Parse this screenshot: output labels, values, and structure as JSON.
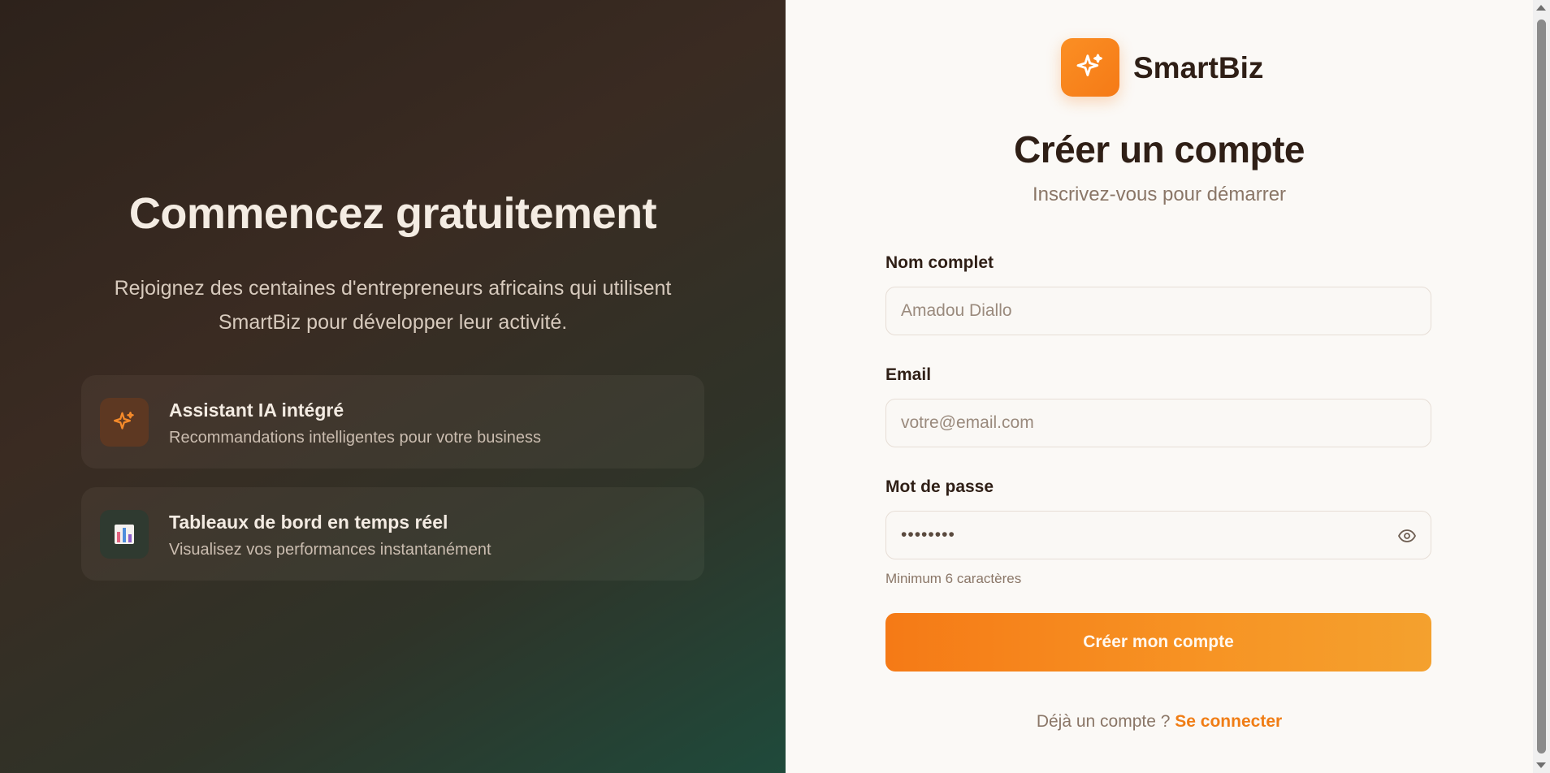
{
  "hero": {
    "title": "Commencez gratuitement",
    "subtitle_line1": "Rejoignez des centaines d'entrepreneurs africains qui utilisent",
    "subtitle_line2": "SmartBiz pour développer leur activité."
  },
  "features": [
    {
      "icon": "sparkles-icon",
      "title": "Assistant IA intégré",
      "description": "Recommandations intelligentes pour votre business"
    },
    {
      "icon": "bar-chart-icon",
      "title": "Tableaux de bord en temps réel",
      "description": "Visualisez vos performances instantanément"
    }
  ],
  "brand": {
    "name": "SmartBiz",
    "icon": "sparkles-icon",
    "accent_color": "#f57a16"
  },
  "form": {
    "title": "Créer un compte",
    "subtitle": "Inscrivez-vous pour démarrer",
    "name_label": "Nom complet",
    "name_placeholder": "Amadou Diallo",
    "email_label": "Email",
    "email_placeholder": "votre@email.com",
    "password_label": "Mot de passe",
    "password_value": "••••••••",
    "password_hint": "Minimum 6 caractères",
    "submit_label": "Créer mon compte",
    "login_prompt": "Déjà un compte ?",
    "login_link": "Se connecter"
  }
}
